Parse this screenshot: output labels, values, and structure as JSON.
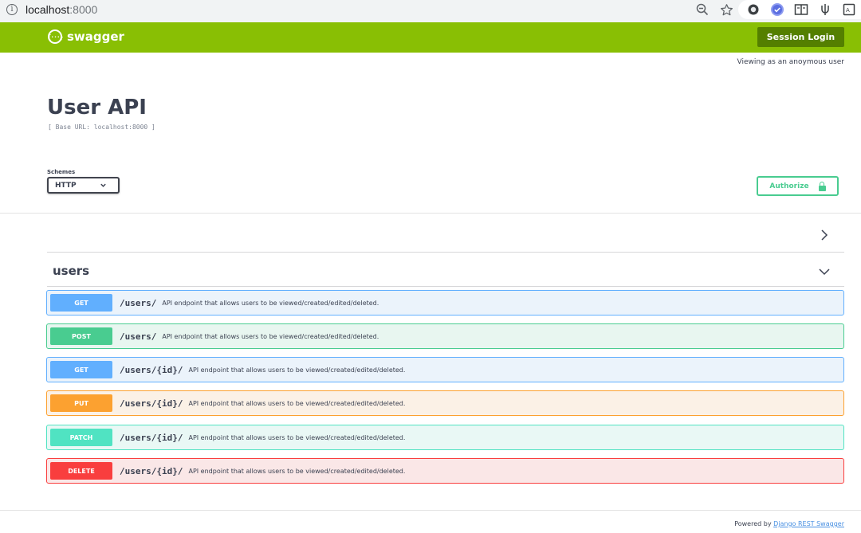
{
  "browser": {
    "url_host": "localhost",
    "url_port": ":8000",
    "icons": [
      "zoom-out-icon",
      "star-icon",
      "extension-icon",
      "check-circle-icon",
      "reading-list-icon",
      "extension-icon",
      "profile-icon"
    ]
  },
  "topbar": {
    "logo_text": "swagger",
    "logo_mark": "{···}",
    "session_login": "Session Login",
    "bg_color": "#89bf04",
    "button_color": "#547f00"
  },
  "viewing_note": "Viewing as an anoymous user",
  "info": {
    "title": "User API",
    "base_url": "[ Base URL: localhost:8000 ]"
  },
  "schemes": {
    "label": "Schemes",
    "selected": "HTTP"
  },
  "authorize": {
    "label": "Authorize"
  },
  "tag": {
    "name": "users"
  },
  "operations": [
    {
      "method": "GET",
      "path": "/users/",
      "summary": "API endpoint that allows users to be viewed/created/edited/deleted.",
      "color": "#61affe",
      "bg": "#ebf3fb"
    },
    {
      "method": "POST",
      "path": "/users/",
      "summary": "API endpoint that allows users to be viewed/created/edited/deleted.",
      "color": "#49cc90",
      "bg": "#e8f6f0"
    },
    {
      "method": "GET",
      "path": "/users/{id}/",
      "summary": "API endpoint that allows users to be viewed/created/edited/deleted.",
      "color": "#61affe",
      "bg": "#ebf3fb"
    },
    {
      "method": "PUT",
      "path": "/users/{id}/",
      "summary": "API endpoint that allows users to be viewed/created/edited/deleted.",
      "color": "#fca130",
      "bg": "#fbf1e6"
    },
    {
      "method": "PATCH",
      "path": "/users/{id}/",
      "summary": "API endpoint that allows users to be viewed/created/edited/deleted.",
      "color": "#50e3c2",
      "bg": "#e9f8f5"
    },
    {
      "method": "DELETE",
      "path": "/users/{id}/",
      "summary": "API endpoint that allows users to be viewed/created/edited/deleted.",
      "color": "#f93e3e",
      "bg": "#fae7e7"
    }
  ],
  "footer": {
    "powered_prefix": "Powered by ",
    "powered_link": "Django REST Swagger"
  }
}
